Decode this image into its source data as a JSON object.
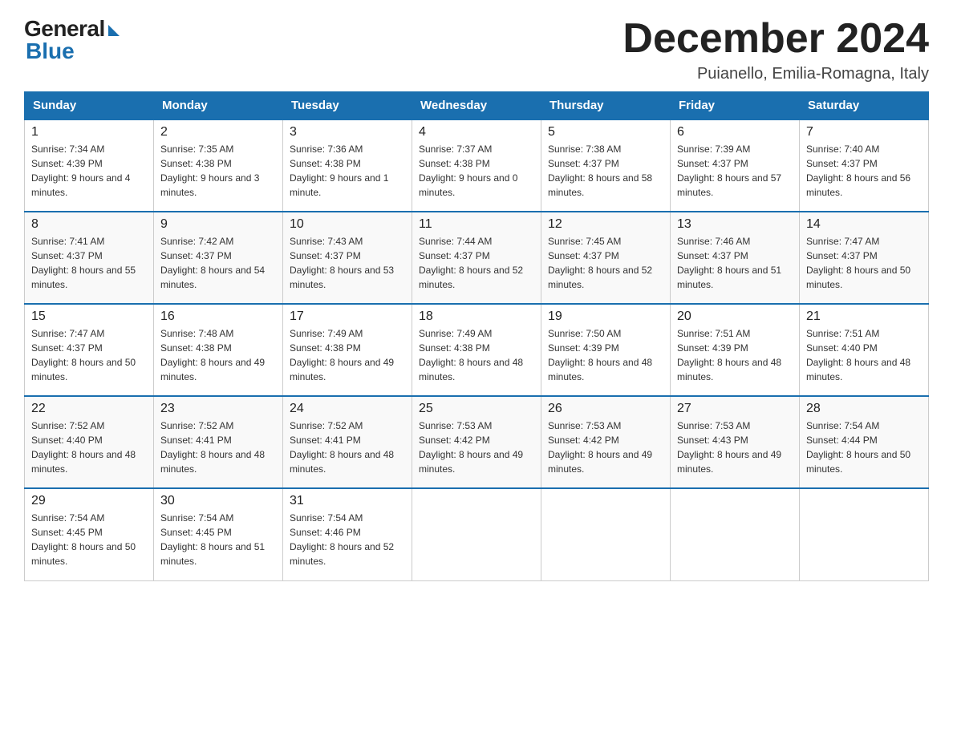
{
  "header": {
    "logo_general": "General",
    "logo_blue": "Blue",
    "month_title": "December 2024",
    "location": "Puianello, Emilia-Romagna, Italy"
  },
  "days_of_week": [
    "Sunday",
    "Monday",
    "Tuesday",
    "Wednesday",
    "Thursday",
    "Friday",
    "Saturday"
  ],
  "weeks": [
    [
      {
        "day": "1",
        "sunrise": "7:34 AM",
        "sunset": "4:39 PM",
        "daylight": "9 hours and 4 minutes."
      },
      {
        "day": "2",
        "sunrise": "7:35 AM",
        "sunset": "4:38 PM",
        "daylight": "9 hours and 3 minutes."
      },
      {
        "day": "3",
        "sunrise": "7:36 AM",
        "sunset": "4:38 PM",
        "daylight": "9 hours and 1 minute."
      },
      {
        "day": "4",
        "sunrise": "7:37 AM",
        "sunset": "4:38 PM",
        "daylight": "9 hours and 0 minutes."
      },
      {
        "day": "5",
        "sunrise": "7:38 AM",
        "sunset": "4:37 PM",
        "daylight": "8 hours and 58 minutes."
      },
      {
        "day": "6",
        "sunrise": "7:39 AM",
        "sunset": "4:37 PM",
        "daylight": "8 hours and 57 minutes."
      },
      {
        "day": "7",
        "sunrise": "7:40 AM",
        "sunset": "4:37 PM",
        "daylight": "8 hours and 56 minutes."
      }
    ],
    [
      {
        "day": "8",
        "sunrise": "7:41 AM",
        "sunset": "4:37 PM",
        "daylight": "8 hours and 55 minutes."
      },
      {
        "day": "9",
        "sunrise": "7:42 AM",
        "sunset": "4:37 PM",
        "daylight": "8 hours and 54 minutes."
      },
      {
        "day": "10",
        "sunrise": "7:43 AM",
        "sunset": "4:37 PM",
        "daylight": "8 hours and 53 minutes."
      },
      {
        "day": "11",
        "sunrise": "7:44 AM",
        "sunset": "4:37 PM",
        "daylight": "8 hours and 52 minutes."
      },
      {
        "day": "12",
        "sunrise": "7:45 AM",
        "sunset": "4:37 PM",
        "daylight": "8 hours and 52 minutes."
      },
      {
        "day": "13",
        "sunrise": "7:46 AM",
        "sunset": "4:37 PM",
        "daylight": "8 hours and 51 minutes."
      },
      {
        "day": "14",
        "sunrise": "7:47 AM",
        "sunset": "4:37 PM",
        "daylight": "8 hours and 50 minutes."
      }
    ],
    [
      {
        "day": "15",
        "sunrise": "7:47 AM",
        "sunset": "4:37 PM",
        "daylight": "8 hours and 50 minutes."
      },
      {
        "day": "16",
        "sunrise": "7:48 AM",
        "sunset": "4:38 PM",
        "daylight": "8 hours and 49 minutes."
      },
      {
        "day": "17",
        "sunrise": "7:49 AM",
        "sunset": "4:38 PM",
        "daylight": "8 hours and 49 minutes."
      },
      {
        "day": "18",
        "sunrise": "7:49 AM",
        "sunset": "4:38 PM",
        "daylight": "8 hours and 48 minutes."
      },
      {
        "day": "19",
        "sunrise": "7:50 AM",
        "sunset": "4:39 PM",
        "daylight": "8 hours and 48 minutes."
      },
      {
        "day": "20",
        "sunrise": "7:51 AM",
        "sunset": "4:39 PM",
        "daylight": "8 hours and 48 minutes."
      },
      {
        "day": "21",
        "sunrise": "7:51 AM",
        "sunset": "4:40 PM",
        "daylight": "8 hours and 48 minutes."
      }
    ],
    [
      {
        "day": "22",
        "sunrise": "7:52 AM",
        "sunset": "4:40 PM",
        "daylight": "8 hours and 48 minutes."
      },
      {
        "day": "23",
        "sunrise": "7:52 AM",
        "sunset": "4:41 PM",
        "daylight": "8 hours and 48 minutes."
      },
      {
        "day": "24",
        "sunrise": "7:52 AM",
        "sunset": "4:41 PM",
        "daylight": "8 hours and 48 minutes."
      },
      {
        "day": "25",
        "sunrise": "7:53 AM",
        "sunset": "4:42 PM",
        "daylight": "8 hours and 49 minutes."
      },
      {
        "day": "26",
        "sunrise": "7:53 AM",
        "sunset": "4:42 PM",
        "daylight": "8 hours and 49 minutes."
      },
      {
        "day": "27",
        "sunrise": "7:53 AM",
        "sunset": "4:43 PM",
        "daylight": "8 hours and 49 minutes."
      },
      {
        "day": "28",
        "sunrise": "7:54 AM",
        "sunset": "4:44 PM",
        "daylight": "8 hours and 50 minutes."
      }
    ],
    [
      {
        "day": "29",
        "sunrise": "7:54 AM",
        "sunset": "4:45 PM",
        "daylight": "8 hours and 50 minutes."
      },
      {
        "day": "30",
        "sunrise": "7:54 AM",
        "sunset": "4:45 PM",
        "daylight": "8 hours and 51 minutes."
      },
      {
        "day": "31",
        "sunrise": "7:54 AM",
        "sunset": "4:46 PM",
        "daylight": "8 hours and 52 minutes."
      },
      null,
      null,
      null,
      null
    ]
  ],
  "labels": {
    "sunrise_prefix": "Sunrise: ",
    "sunset_prefix": "Sunset: ",
    "daylight_prefix": "Daylight: "
  }
}
